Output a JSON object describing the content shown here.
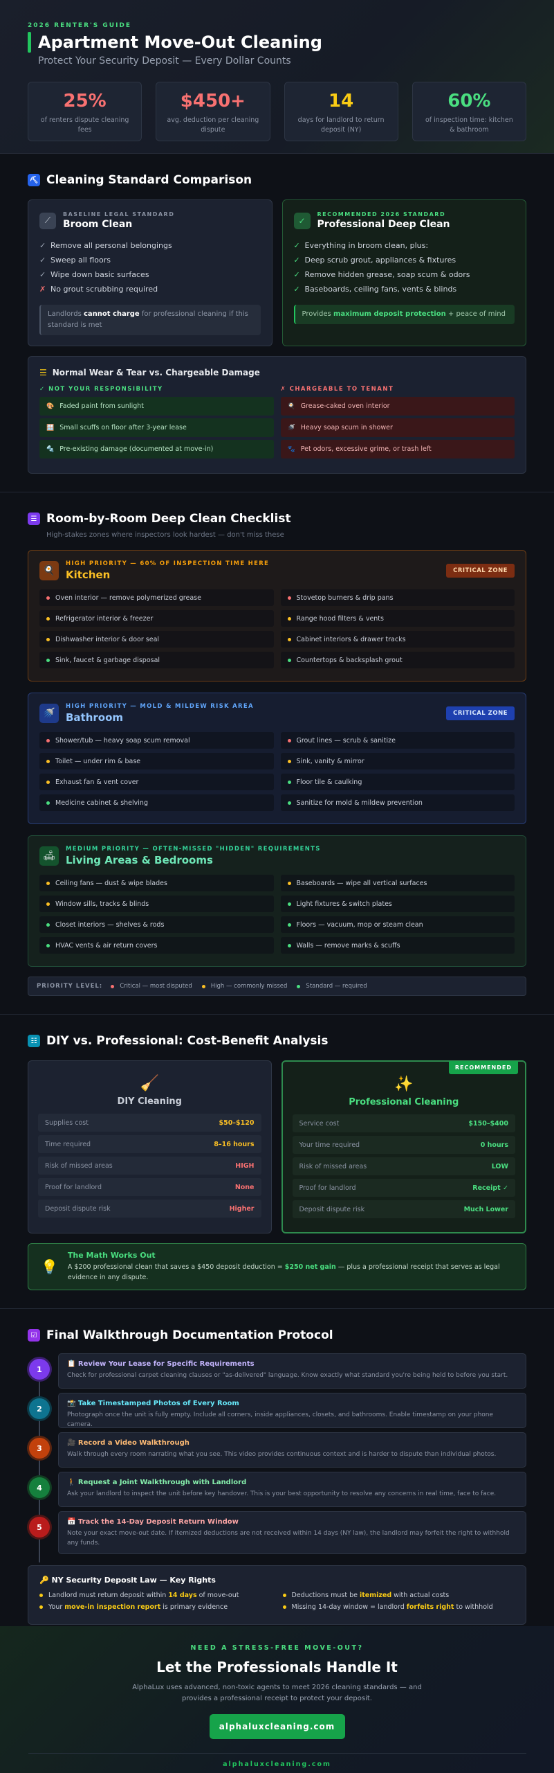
{
  "header": {
    "eyebrow": "2026 RENTER'S GUIDE",
    "title": "Apartment Move-Out Cleaning",
    "subtitle": "Protect Your Security Deposit — Every Dollar Counts",
    "stats": [
      {
        "value": "25%",
        "label": "of renters dispute cleaning fees",
        "color": "#f87171"
      },
      {
        "value": "$450+",
        "label": "avg. deduction per cleaning dispute",
        "color": "#f87171"
      },
      {
        "value": "14",
        "label": "days for landlord to return deposit (NY)",
        "color": "#facc15"
      },
      {
        "value": "60%",
        "label": "of inspection time: kitchen & bathroom",
        "color": "#4ade80"
      }
    ]
  },
  "comparison": {
    "title": "Cleaning Standard Comparison",
    "broom": {
      "tag": "BASELINE LEGAL STANDARD",
      "name": "Broom Clean",
      "items": [
        {
          "mark": "✓",
          "text": "Remove all personal belongings"
        },
        {
          "mark": "✓",
          "text": "Sweep all floors"
        },
        {
          "mark": "✓",
          "text": "Wipe down basic surfaces"
        },
        {
          "mark": "✗",
          "text": "No grout scrubbing required"
        }
      ],
      "note_pre": "Landlords ",
      "note_bold": "cannot charge",
      "note_post": " for professional cleaning if this standard is met"
    },
    "deep": {
      "tag": "RECOMMENDED 2026 STANDARD",
      "name": "Professional Deep Clean",
      "items": [
        {
          "mark": "✓",
          "text": "Everything in broom clean, plus:"
        },
        {
          "mark": "✓",
          "text": "Deep scrub grout, appliances & fixtures"
        },
        {
          "mark": "✓",
          "text": "Remove hidden grease, soap scum & odors"
        },
        {
          "mark": "✓",
          "text": "Baseboards, ceiling fans, vents & blinds"
        }
      ],
      "note_pre": "Provides ",
      "note_bold": "maximum deposit protection",
      "note_post": " + peace of mind"
    },
    "wear": {
      "title": "Normal Wear & Tear vs. Chargeable Damage",
      "ok_title": "✓ NOT YOUR RESPONSIBILITY",
      "bad_title": "✗ CHARGEABLE TO TENANT",
      "ok_items": [
        {
          "icon": "🎨",
          "text": "Faded paint from sunlight"
        },
        {
          "icon": "🪟",
          "text": "Small scuffs on floor after 3-year lease"
        },
        {
          "icon": "🔩",
          "text": "Pre-existing damage (documented at move-in)"
        }
      ],
      "bad_items": [
        {
          "icon": "🍳",
          "text": "Grease-caked oven interior"
        },
        {
          "icon": "🚿",
          "text": "Heavy soap scum in shower"
        },
        {
          "icon": "🐾",
          "text": "Pet odors, excessive grime, or trash left"
        }
      ]
    }
  },
  "rooms": {
    "title": "Room-by-Room Deep Clean Checklist",
    "subtitle": "High-stakes zones where inspectors look hardest — don't miss these",
    "kitchen": {
      "tag": "HIGH PRIORITY — 60% OF INSPECTION TIME HERE",
      "name": "Kitchen",
      "badge": "CRITICAL ZONE",
      "items": [
        {
          "p": "c",
          "text": "Oven interior — remove polymerized grease"
        },
        {
          "p": "c",
          "text": "Stovetop burners & drip pans"
        },
        {
          "p": "h",
          "text": "Refrigerator interior & freezer"
        },
        {
          "p": "h",
          "text": "Range hood filters & vents"
        },
        {
          "p": "h",
          "text": "Dishwasher interior & door seal"
        },
        {
          "p": "h",
          "text": "Cabinet interiors & drawer tracks"
        },
        {
          "p": "s",
          "text": "Sink, faucet & garbage disposal"
        },
        {
          "p": "s",
          "text": "Countertops & backsplash grout"
        }
      ]
    },
    "bathroom": {
      "tag": "HIGH PRIORITY — MOLD & MILDEW RISK AREA",
      "name": "Bathroom",
      "badge": "CRITICAL ZONE",
      "items": [
        {
          "p": "c",
          "text": "Shower/tub — heavy soap scum removal"
        },
        {
          "p": "c",
          "text": "Grout lines — scrub & sanitize"
        },
        {
          "p": "h",
          "text": "Toilet — under rim & base"
        },
        {
          "p": "h",
          "text": "Sink, vanity & mirror"
        },
        {
          "p": "h",
          "text": "Exhaust fan & vent cover"
        },
        {
          "p": "s",
          "text": "Floor tile & caulking"
        },
        {
          "p": "s",
          "text": "Medicine cabinet & shelving"
        },
        {
          "p": "s",
          "text": "Sanitize for mold & mildew prevention"
        }
      ]
    },
    "living": {
      "tag": "MEDIUM PRIORITY — OFTEN-MISSED \"HIDDEN\" REQUIREMENTS",
      "name": "Living Areas & Bedrooms",
      "items": [
        {
          "p": "h",
          "text": "Ceiling fans — dust & wipe blades"
        },
        {
          "p": "h",
          "text": "Baseboards — wipe all vertical surfaces"
        },
        {
          "p": "h",
          "text": "Window sills, tracks & blinds"
        },
        {
          "p": "s",
          "text": "Light fixtures & switch plates"
        },
        {
          "p": "s",
          "text": "Closet interiors — shelves & rods"
        },
        {
          "p": "s",
          "text": "Floors — vacuum, mop or steam clean"
        },
        {
          "p": "s",
          "text": "HVAC vents & air return covers"
        },
        {
          "p": "s",
          "text": "Walls — remove marks & scuffs"
        }
      ]
    },
    "legend": {
      "title": "PRIORITY LEVEL:",
      "critical": "Critical — most disputed",
      "high": "High — commonly missed",
      "standard": "Standard — required"
    }
  },
  "cost": {
    "title": "DIY vs. Professional: Cost-Benefit Analysis",
    "ribbon": "RECOMMENDED",
    "diy": {
      "name": "DIY Cleaning",
      "rows": [
        {
          "k": "Supplies cost",
          "v": "$50–$120",
          "color": "#fbbf24"
        },
        {
          "k": "Time required",
          "v": "8–16 hours",
          "color": "#fbbf24"
        },
        {
          "k": "Risk of missed areas",
          "v": "HIGH",
          "color": "#f87171"
        },
        {
          "k": "Proof for landlord",
          "v": "None",
          "color": "#f87171"
        },
        {
          "k": "Deposit dispute risk",
          "v": "Higher",
          "color": "#f87171"
        }
      ]
    },
    "pro": {
      "name": "Professional Cleaning",
      "rows": [
        {
          "k": "Service cost",
          "v": "$150–$400",
          "color": "#4ade80"
        },
        {
          "k": "Your time required",
          "v": "0 hours",
          "color": "#4ade80"
        },
        {
          "k": "Risk of missed areas",
          "v": "LOW",
          "color": "#4ade80"
        },
        {
          "k": "Proof for landlord",
          "v": "Receipt ✓",
          "color": "#4ade80"
        },
        {
          "k": "Deposit dispute risk",
          "v": "Much Lower",
          "color": "#4ade80"
        }
      ]
    },
    "math": {
      "title": "The Math Works Out",
      "pre": "A $200 professional clean that saves a $450 deposit deduction = ",
      "bold": "$250 net gain",
      "post": " — plus a professional receipt that serves as legal evidence in any dispute."
    }
  },
  "walkthrough": {
    "title": "Final Walkthrough Documentation Protocol",
    "steps": [
      {
        "n": "1",
        "title": "📋 Review Your Lease for Specific Requirements",
        "desc": "Check for professional carpet cleaning clauses or \"as-delivered\" language. Know exactly what standard you're being held to before you start.",
        "color": "#7c3aed",
        "tcolor": "#c4b5fd"
      },
      {
        "n": "2",
        "title": "📸 Take Timestamped Photos of Every Room",
        "desc": "Photograph once the unit is fully empty. Include all corners, inside appliances, closets, and bathrooms. Enable timestamp on your phone camera.",
        "color": "#0e7490",
        "tcolor": "#67e8f9"
      },
      {
        "n": "3",
        "title": "🎥 Record a Video Walkthrough",
        "desc": "Walk through every room narrating what you see. This video provides continuous context and is harder to dispute than individual photos.",
        "color": "#c2410c",
        "tcolor": "#fdba74"
      },
      {
        "n": "4",
        "title": "🚶 Request a Joint Walkthrough with Landlord",
        "desc": "Ask your landlord to inspect the unit before key handover. This is your best opportunity to resolve any concerns in real time, face to face.",
        "color": "#15803d",
        "tcolor": "#86efac"
      },
      {
        "n": "5",
        "title": "📅 Track the 14-Day Deposit Return Window",
        "desc": "Note your exact move-out date. If itemized deductions are not received within 14 days (NY law), the landlord may forfeit the right to withhold any funds.",
        "color": "#b91c1c",
        "tcolor": "#fca5a5"
      }
    ],
    "law": {
      "title": "🔑 NY Security Deposit Law — Key Rights",
      "items": [
        {
          "pre": "Landlord must return deposit within",
          "bold": "14 days",
          "post": "of move-out"
        },
        {
          "pre": "Deductions must be",
          "bold": "itemized",
          "post": "with actual costs"
        },
        {
          "pre": "Your",
          "bold": "move-in inspection report",
          "post": "is primary evidence"
        },
        {
          "pre": "Missing 14-day window = landlord",
          "bold": "forfeits right",
          "post": "to withhold"
        }
      ]
    }
  },
  "footer": {
    "eyebrow": "NEED A STRESS-FREE MOVE-OUT?",
    "title": "Let the Professionals Handle It",
    "desc1": "AlphaLux uses advanced, non-toxic agents to meet 2026 cleaning standards — and",
    "desc2": "provides a professional receipt to protect your deposit.",
    "button": "alphaluxcleaning.com",
    "site": "alphaluxcleaning.com"
  },
  "colors": {
    "critical": "#f87171",
    "high": "#fbbf24",
    "standard": "#4ade80"
  }
}
